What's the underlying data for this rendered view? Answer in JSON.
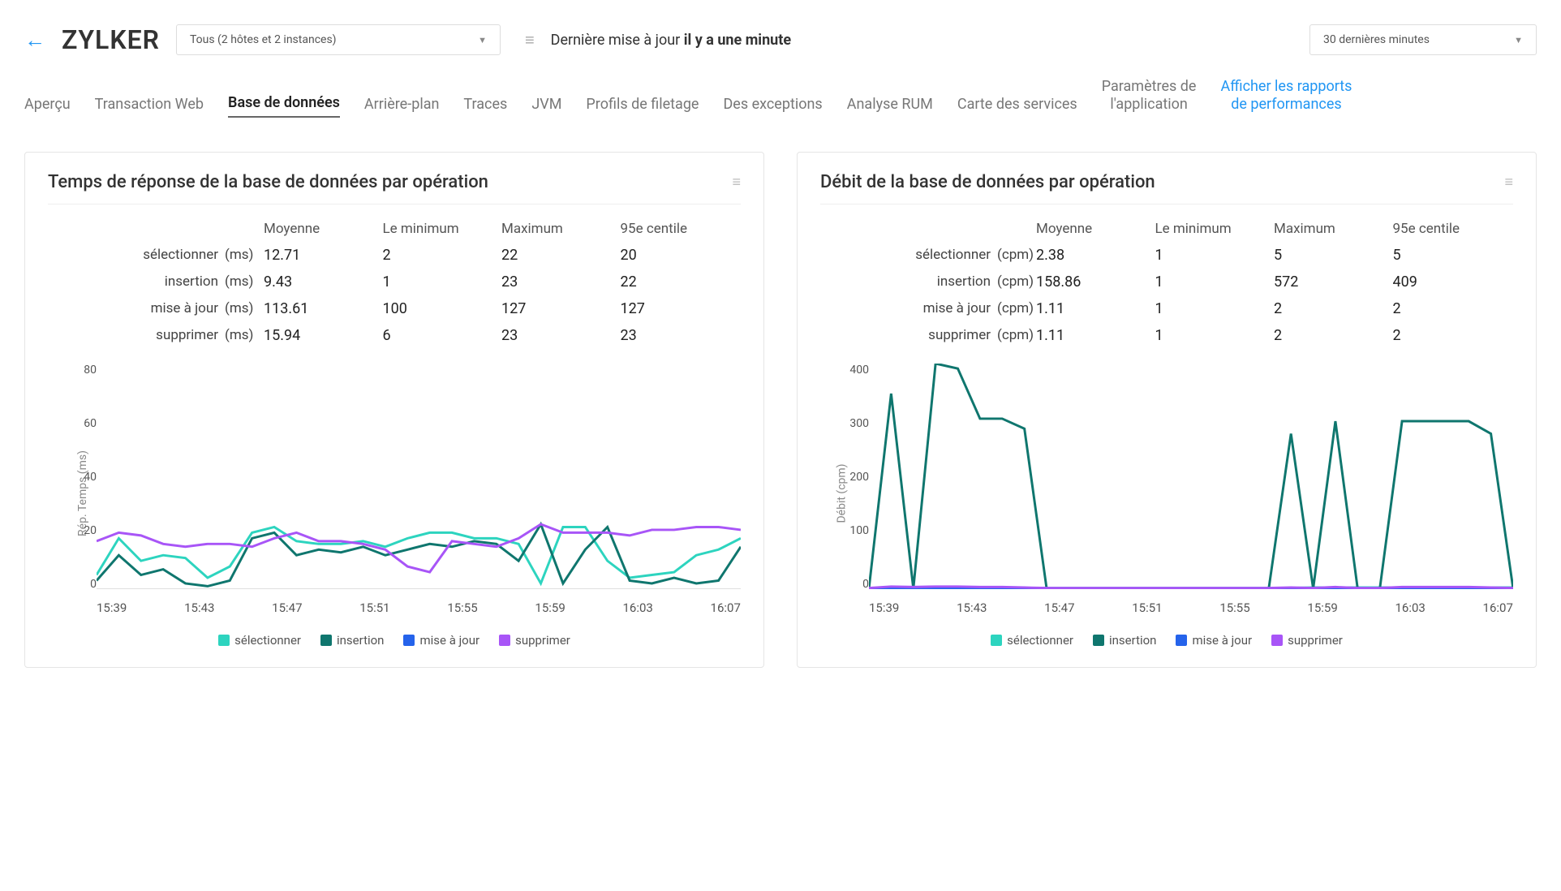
{
  "header": {
    "app_name": "ZYLKER",
    "host_dropdown": "Tous (2 hôtes et 2 instances)",
    "last_update_label": "Dernière mise à jour",
    "last_update_value": "il y a une minute",
    "time_dropdown": "30 dernières minutes"
  },
  "tabs": {
    "overview": "Aperçu",
    "web_tx": "Transaction Web",
    "database": "Base de données",
    "background": "Arrière-plan",
    "traces": "Traces",
    "jvm": "JVM",
    "thread_profiles": "Profils de filetage",
    "exceptions": "Des exceptions",
    "rum": "Analyse RUM",
    "service_map": "Carte des services",
    "app_params_l1": "Paramètres de",
    "app_params_l2": "l'application",
    "reports_l1": "Afficher les rapports",
    "reports_l2": "de performances"
  },
  "table_headers": {
    "avg": "Moyenne",
    "min": "Le minimum",
    "max": "Maximum",
    "p95": "95e centile"
  },
  "row_labels": {
    "select": "sélectionner",
    "insert": "insertion",
    "update": "mise à jour",
    "delete": "supprimer"
  },
  "left_panel": {
    "title": "Temps de réponse de la base de données par opération",
    "unit": "(ms)",
    "ylabel": "Rép. Temps (ms)",
    "rows": {
      "select": {
        "avg": "12.71",
        "min": "2",
        "max": "22",
        "p95": "20"
      },
      "insert": {
        "avg": "9.43",
        "min": "1",
        "max": "23",
        "p95": "22"
      },
      "update": {
        "avg": "113.61",
        "min": "100",
        "max": "127",
        "p95": "127"
      },
      "delete": {
        "avg": "15.94",
        "min": "6",
        "max": "23",
        "p95": "23"
      }
    }
  },
  "right_panel": {
    "title": "Débit de la base de données par opération",
    "unit": "(cpm)",
    "ylabel": "Débit (cpm)",
    "rows": {
      "select": {
        "avg": "2.38",
        "min": "1",
        "max": "5",
        "p95": "5"
      },
      "insert": {
        "avg": "158.86",
        "min": "1",
        "max": "572",
        "p95": "409"
      },
      "update": {
        "avg": "1.11",
        "min": "1",
        "max": "2",
        "p95": "2"
      },
      "delete": {
        "avg": "1.11",
        "min": "1",
        "max": "2",
        "p95": "2"
      }
    }
  },
  "chart_data": [
    {
      "type": "line",
      "title": "Temps de réponse de la base de données par opération",
      "xlabel": "",
      "ylabel": "Rép. Temps (ms)",
      "ylim": [
        0,
        80
      ],
      "x": [
        "15:39",
        "15:40",
        "15:41",
        "15:42",
        "15:43",
        "15:44",
        "15:45",
        "15:46",
        "15:47",
        "15:48",
        "15:49",
        "15:50",
        "15:51",
        "15:52",
        "15:53",
        "15:54",
        "15:55",
        "15:56",
        "15:57",
        "15:58",
        "15:59",
        "16:00",
        "16:01",
        "16:02",
        "16:03",
        "16:04",
        "16:05",
        "16:06",
        "16:07",
        "16:08"
      ],
      "series": [
        {
          "name": "sélectionner",
          "color": "#2dd4bf",
          "values": [
            5,
            18,
            10,
            12,
            11,
            4,
            8,
            20,
            22,
            17,
            16,
            16,
            17,
            15,
            18,
            20,
            20,
            18,
            18,
            16,
            2,
            22,
            22,
            10,
            4,
            5,
            6,
            12,
            14,
            18
          ]
        },
        {
          "name": "insertion",
          "color": "#0f766e",
          "values": [
            3,
            12,
            5,
            7,
            2,
            1,
            3,
            18,
            20,
            12,
            14,
            13,
            15,
            12,
            14,
            16,
            15,
            17,
            16,
            10,
            23,
            2,
            14,
            22,
            3,
            2,
            4,
            2,
            3,
            15
          ]
        },
        {
          "name": "mise à jour",
          "color": "#2563eb",
          "values": [
            null,
            null,
            null,
            null,
            null,
            null,
            null,
            null,
            null,
            null,
            null,
            null,
            null,
            null,
            null,
            null,
            null,
            null,
            null,
            null,
            null,
            null,
            null,
            null,
            null,
            null,
            null,
            null,
            null,
            null
          ]
        },
        {
          "name": "supprimer",
          "color": "#a855f7",
          "values": [
            17,
            20,
            19,
            16,
            15,
            16,
            16,
            15,
            18,
            20,
            17,
            17,
            16,
            14,
            8,
            6,
            17,
            16,
            15,
            18,
            23,
            20,
            20,
            20,
            19,
            21,
            21,
            22,
            22,
            21
          ]
        }
      ],
      "xticks": [
        "15:39",
        "15:43",
        "15:47",
        "15:51",
        "15:55",
        "15:59",
        "16:03",
        "16:07"
      ]
    },
    {
      "type": "line",
      "title": "Débit de la base de données par opération",
      "xlabel": "",
      "ylabel": "Débit (cpm)",
      "ylim": [
        0,
        450
      ],
      "x": [
        "15:39",
        "15:40",
        "15:41",
        "15:42",
        "15:43",
        "15:44",
        "15:45",
        "15:46",
        "15:47",
        "15:48",
        "15:49",
        "15:50",
        "15:51",
        "15:52",
        "15:53",
        "15:54",
        "15:55",
        "15:56",
        "15:57",
        "15:58",
        "15:59",
        "16:00",
        "16:01",
        "16:02",
        "16:03",
        "16:04",
        "16:05",
        "16:06",
        "16:07",
        "16:08"
      ],
      "series": [
        {
          "name": "sélectionner",
          "color": "#2dd4bf",
          "values": [
            2,
            2,
            2,
            3,
            3,
            3,
            3,
            2,
            2,
            2,
            2,
            2,
            2,
            2,
            2,
            2,
            2,
            2,
            2,
            2,
            3,
            3,
            3,
            3,
            3,
            3,
            3,
            3,
            3,
            3
          ]
        },
        {
          "name": "insertion",
          "color": "#0f766e",
          "values": [
            1,
            390,
            1,
            450,
            440,
            340,
            340,
            320,
            1,
            1,
            1,
            1,
            1,
            1,
            1,
            1,
            1,
            1,
            1,
            310,
            1,
            335,
            1,
            1,
            335,
            335,
            335,
            335,
            310,
            1
          ]
        },
        {
          "name": "mise à jour",
          "color": "#2563eb",
          "values": [
            1,
            1,
            1,
            1,
            1,
            1,
            1,
            1,
            1,
            1,
            1,
            1,
            1,
            1,
            1,
            1,
            1,
            1,
            1,
            1,
            1,
            1,
            1,
            1,
            1,
            1,
            1,
            1,
            1,
            1
          ]
        },
        {
          "name": "supprimer",
          "color": "#a855f7",
          "values": [
            2,
            5,
            4,
            5,
            5,
            4,
            4,
            3,
            2,
            2,
            2,
            2,
            2,
            2,
            2,
            2,
            2,
            2,
            2,
            3,
            2,
            4,
            2,
            2,
            4,
            4,
            4,
            4,
            3,
            2
          ]
        }
      ],
      "xticks": [
        "15:39",
        "15:43",
        "15:47",
        "15:51",
        "15:55",
        "15:59",
        "16:03",
        "16:07"
      ]
    }
  ],
  "legend": {
    "select": "sélectionner",
    "insert": "insertion",
    "update": "mise à jour",
    "delete": "supprimer"
  },
  "y_ticks_left": [
    "80",
    "60",
    "40",
    "20",
    "0"
  ],
  "y_ticks_right": [
    "400",
    "300",
    "200",
    "100",
    "0"
  ]
}
